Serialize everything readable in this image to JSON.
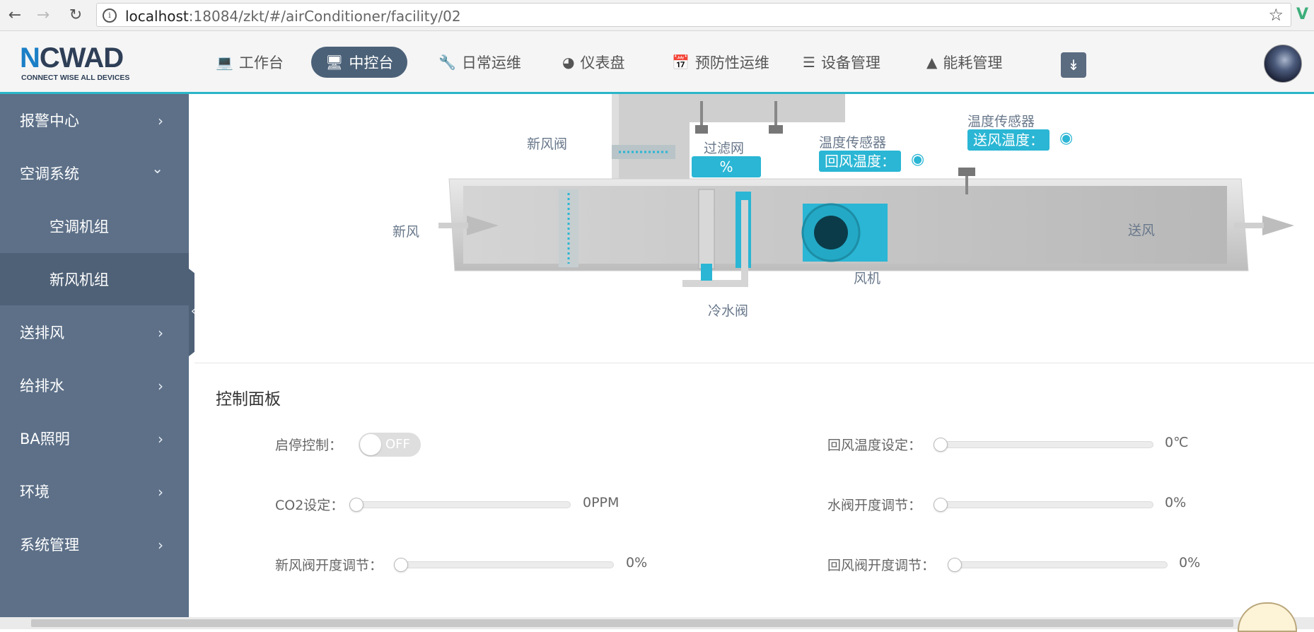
{
  "browser": {
    "url_host": "localhost",
    "url_rest": ":18084/zkt/#/airConditioner/facility/02"
  },
  "logo": {
    "word_a": "N",
    "word_b": "CWAD",
    "tagline": "CONNECT WISE ALL DEVICES"
  },
  "topnav": [
    {
      "label": "工作台",
      "icon": "laptop-icon"
    },
    {
      "label": "中控台",
      "icon": "monitor-icon",
      "active": true
    },
    {
      "label": "日常运维",
      "icon": "wrench-icon"
    },
    {
      "label": "仪表盘",
      "icon": "dashboard-icon"
    },
    {
      "label": "预防性运维",
      "icon": "calendar-check-icon"
    },
    {
      "label": "设备管理",
      "icon": "server-icon"
    },
    {
      "label": "能耗管理",
      "icon": "area-chart-icon"
    }
  ],
  "sidebar": [
    {
      "label": "报警中心"
    },
    {
      "label": "空调系统",
      "expanded": true
    },
    {
      "label": "空调机组",
      "sub": true
    },
    {
      "label": "新风机组",
      "sub": true,
      "selected": true
    },
    {
      "label": "送排风"
    },
    {
      "label": "给排水"
    },
    {
      "label": "BA照明"
    },
    {
      "label": "环境"
    },
    {
      "label": "系统管理"
    }
  ],
  "diagram": {
    "fresh_air_valve": "新风阀",
    "fresh_air": "新风",
    "filter": "过滤网",
    "filter_value": "%",
    "temp_sensor_1": "温度传感器",
    "return_temp": "回风温度：",
    "temp_sensor_2": "温度传感器",
    "supply_temp": "送风温度：",
    "supply_air": "送风",
    "fan": "风机",
    "chilled_valve": "冷水阀"
  },
  "panel": {
    "title": "控制面板",
    "start_stop_label": "启停控制：",
    "toggle_text": "OFF",
    "co2_label": "CO2设定：",
    "co2_value": "0PPM",
    "co2_level": 0,
    "fresh_valve_label": "新风阀开度调节：",
    "fresh_valve_value": "0%",
    "fresh_valve_level": 0,
    "return_temp_set_label": "回风温度设定：",
    "return_temp_set_value": "0℃",
    "return_temp_set_level": 0,
    "water_valve_label": "水阀开度调节：",
    "water_valve_value": "0%",
    "water_valve_level": 0,
    "return_valve_label": "回风阀开度调节：",
    "return_valve_value": "0%",
    "return_valve_level": 0
  },
  "colors": {
    "accent": "#2ab6d4",
    "sidebar": "#5d7088",
    "nav_active": "#4b6178"
  }
}
